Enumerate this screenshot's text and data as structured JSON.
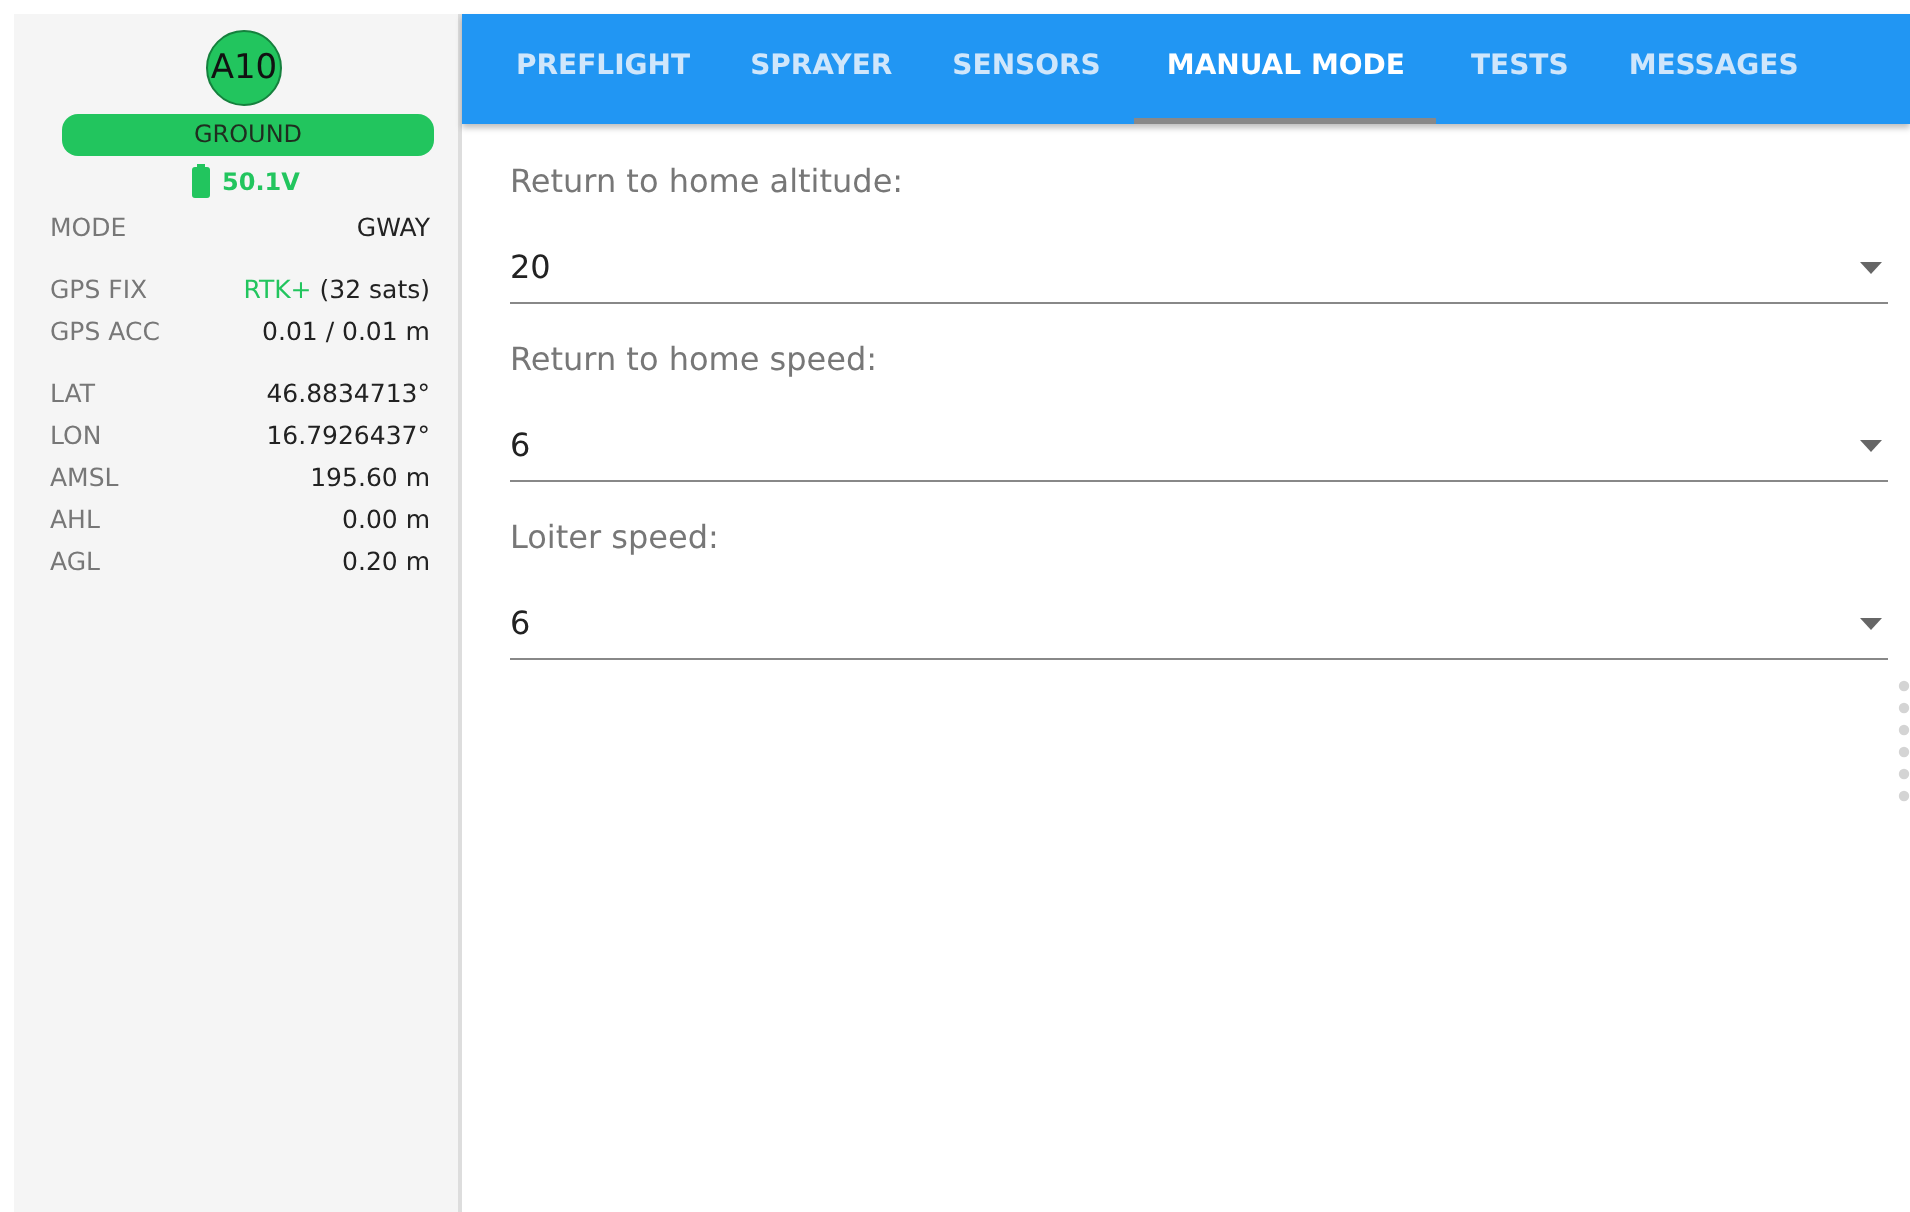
{
  "sidebar": {
    "vehicle_id": "A10",
    "state": "GROUND",
    "battery": "50.1V",
    "rows": [
      {
        "label": "MODE",
        "value": "GWAY"
      },
      {
        "label": "GPS FIX",
        "fix": "RTK+",
        "value": "(32 sats)"
      },
      {
        "label": "GPS ACC",
        "value": "0.01 / 0.01 m"
      },
      {
        "label": "LAT",
        "value": "46.8834713°"
      },
      {
        "label": "LON",
        "value": "16.7926437°"
      },
      {
        "label": "AMSL",
        "value": "195.60 m"
      },
      {
        "label": "AHL",
        "value": "0.00 m"
      },
      {
        "label": "AGL",
        "value": "0.20 m"
      }
    ]
  },
  "tabs": [
    {
      "label": "PREFLIGHT",
      "selected": false
    },
    {
      "label": "SPRAYER",
      "selected": false
    },
    {
      "label": "SENSORS",
      "selected": false
    },
    {
      "label": "MANUAL MODE",
      "selected": true
    },
    {
      "label": "TESTS",
      "selected": false
    },
    {
      "label": "MESSAGES",
      "selected": false
    }
  ],
  "fields": [
    {
      "label": "Return to home altitude:",
      "value": "20"
    },
    {
      "label": "Return to home speed:",
      "value": "6"
    },
    {
      "label": "Loiter speed:",
      "value": "6"
    }
  ]
}
